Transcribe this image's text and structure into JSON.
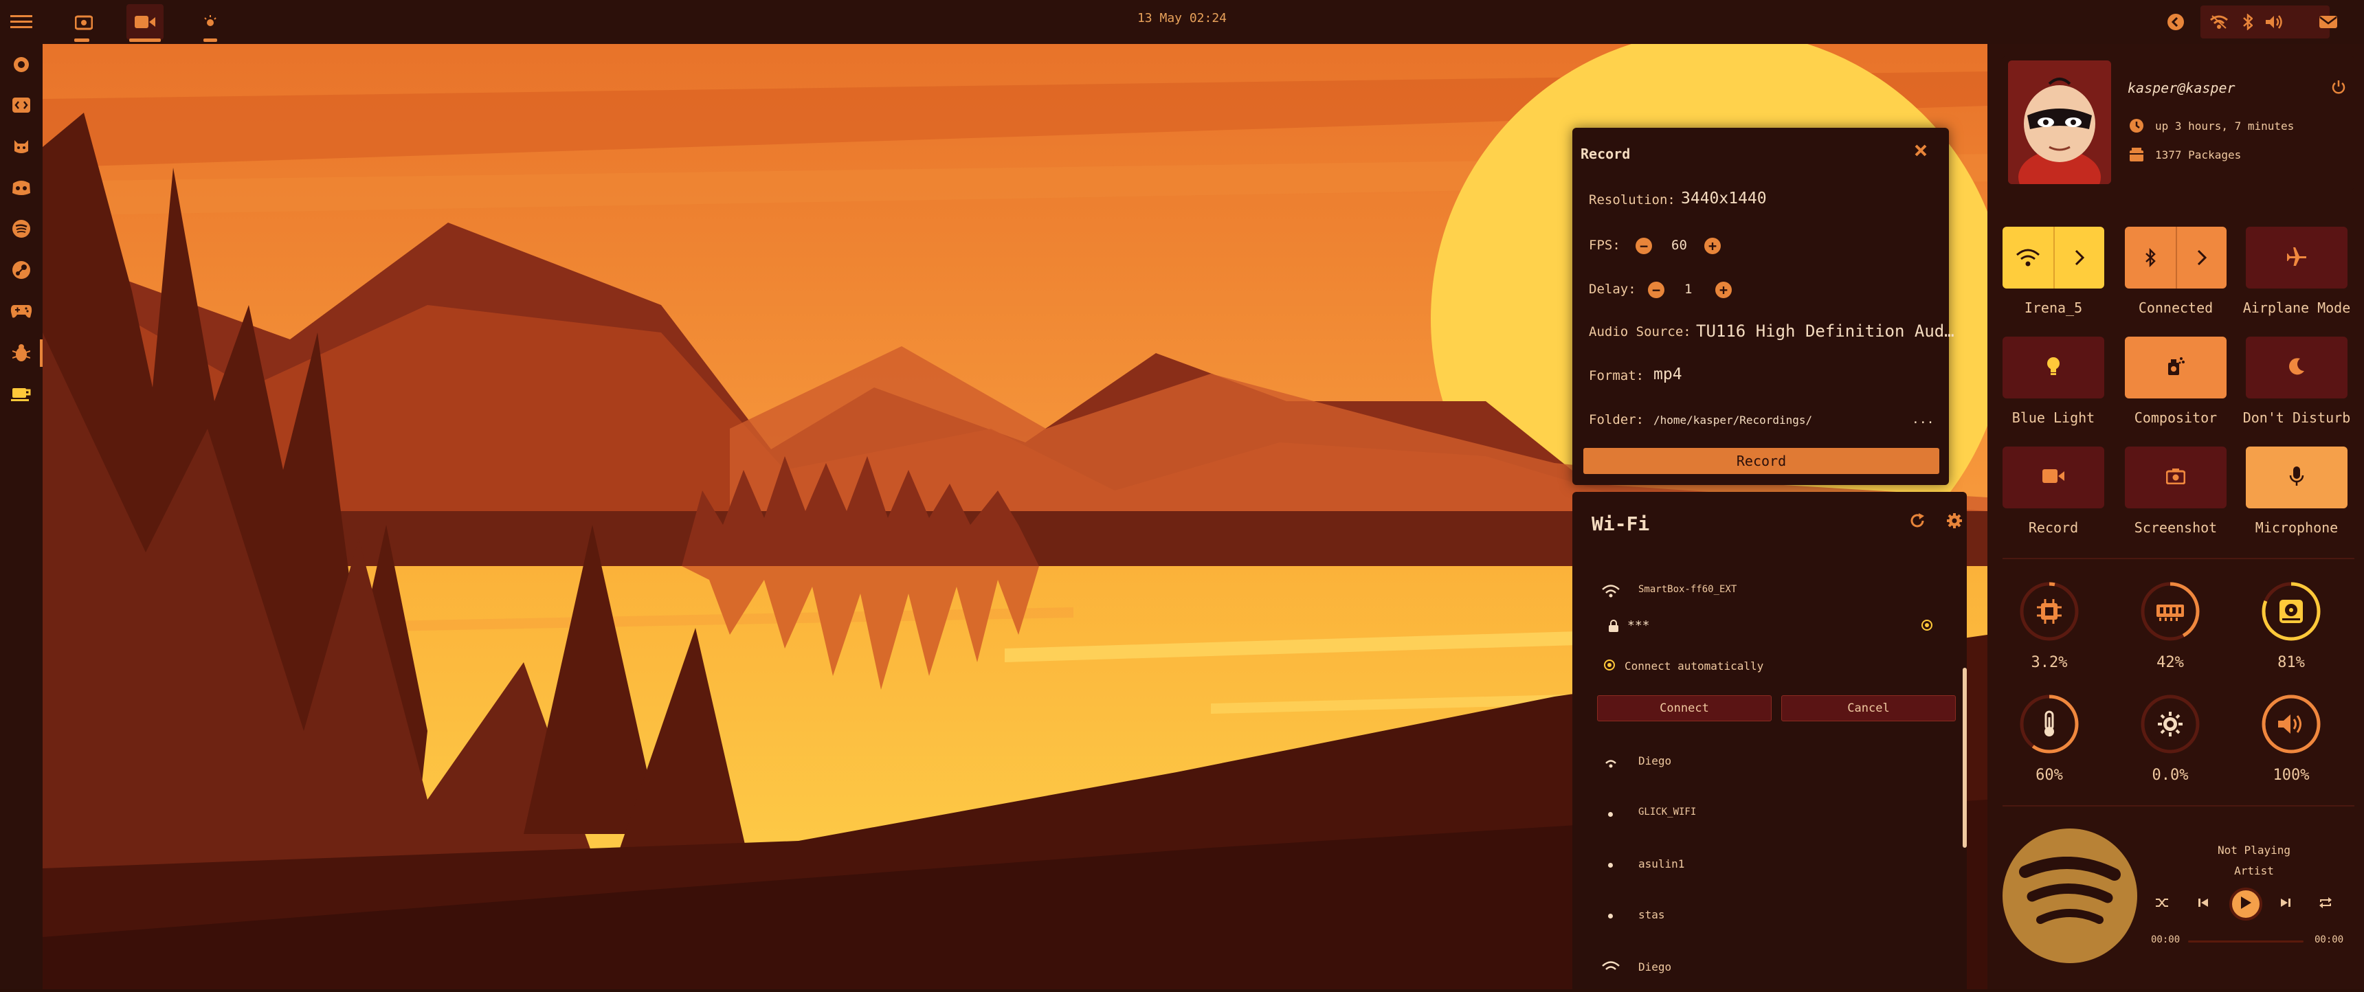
{
  "topbar": {
    "menu_icon": "hamburger-menu-icon",
    "clock": "13 May 02:24",
    "workspace_icons": [
      "screenshot-icon",
      "record-icon",
      "light-icon"
    ],
    "tray_icons": [
      "back-arrow-icon",
      "wifi-icon",
      "bluetooth-icon",
      "volume-icon",
      "mail-icon"
    ]
  },
  "dock": {
    "items": [
      "power-icon",
      "code-icon",
      "github-icon",
      "discord-icon",
      "spotify-icon",
      "steam-icon",
      "gamepad-icon",
      "bug-icon",
      "coffee-icon"
    ]
  },
  "record": {
    "title": "Record",
    "resolution_label": "Resolution:",
    "resolution": "3440x1440",
    "fps_label": "FPS:",
    "fps": "60",
    "delay_label": "Delay:",
    "delay": "1",
    "audio_label": "Audio Source:",
    "audio": "TU116 High Definition Aud…",
    "format_label": "Format:",
    "format": "mp4",
    "folder_label": "Folder:",
    "folder": "/home/kasper/Recordings/",
    "folder_more": "...",
    "record_button": "Record"
  },
  "wifi": {
    "title": "Wi-Fi",
    "selected_network": "SmartBox-ff60_EXT",
    "password": "***",
    "auto_connect": "Connect automatically",
    "connect": "Connect",
    "cancel": "Cancel",
    "networks": [
      "Diego",
      "GLICK_WIFI",
      "asulin1",
      "stas",
      "Diego"
    ]
  },
  "profile": {
    "user": "kasper@kasper",
    "uptime": "up 3 hours, 7 minutes",
    "packages": "1377 Packages"
  },
  "toggles": [
    {
      "label": "Irena_5",
      "icon": "wifi-icon"
    },
    {
      "label": "Connected",
      "icon": "bluetooth-icon"
    },
    {
      "label": "Airplane Mode",
      "icon": "airplane-icon"
    },
    {
      "label": "Blue Light",
      "icon": "bulb-icon"
    },
    {
      "label": "Compositor",
      "icon": "compositor-icon"
    },
    {
      "label": "Don't Disturb",
      "icon": "moon-icon"
    },
    {
      "label": "Record",
      "icon": "record-icon"
    },
    {
      "label": "Screenshot",
      "icon": "camera-icon"
    },
    {
      "label": "Microphone",
      "icon": "microphone-icon"
    }
  ],
  "stats": [
    {
      "label": "3.2%",
      "icon": "cpu-icon",
      "fraction": 0.032
    },
    {
      "label": "42%",
      "icon": "ram-icon",
      "fraction": 0.42
    },
    {
      "label": "81%",
      "icon": "disk-icon",
      "fraction": 0.81
    },
    {
      "label": "60%",
      "icon": "thermometer-icon",
      "fraction": 0.6
    },
    {
      "label": "0.0%",
      "icon": "brightness-icon",
      "fraction": 0.0
    },
    {
      "label": "100%",
      "icon": "volume-icon",
      "fraction": 1.0
    }
  ],
  "player": {
    "status": "Not Playing",
    "artist": "Artist",
    "time_start": "00:00",
    "time_end": "00:00"
  },
  "colors": {
    "accent": "#f5a04a",
    "accent_bright": "#ffc93a",
    "tile_dark": "#5a1414",
    "panel_bg": "#2e100a"
  }
}
